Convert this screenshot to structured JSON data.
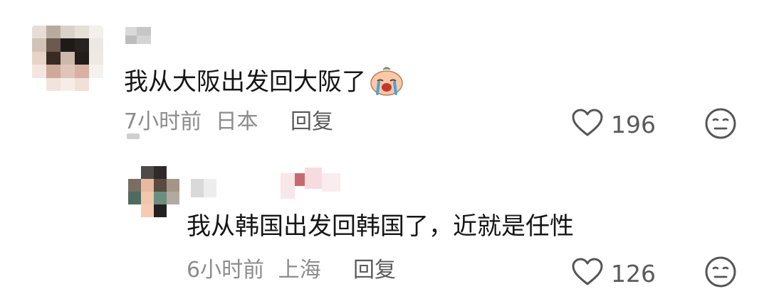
{
  "comments": [
    {
      "text": "我从大阪出发回大阪了",
      "emoji_icon": "crying-face-icon",
      "time": "7小时前",
      "location": "日本",
      "reply_label": "回复",
      "likes": "196"
    },
    {
      "text": "我从韩国出发回韩国了，近就是任性",
      "time": "6小时前",
      "location": "上海",
      "reply_label": "回复",
      "likes": "126"
    }
  ],
  "colors": {
    "text": "#161616",
    "meta": "#8c8c8c",
    "icon": "#555555"
  }
}
